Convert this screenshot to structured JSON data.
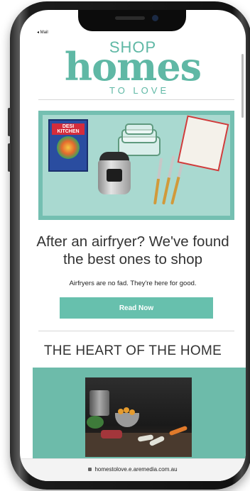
{
  "status_bar": {
    "back_label": "◂ Mail"
  },
  "brand": {
    "top": "SHOP",
    "main": "homes",
    "bottom": "TO LOVE"
  },
  "hero_card": {
    "book_title": "DESI KITCHEN",
    "headline": "After an airfryer? We've found the best ones to shop",
    "subline": "Airfryers are no fad. They're here for good.",
    "cta_label": "Read Now"
  },
  "section": {
    "title": "THE HEART OF THE HOME"
  },
  "browser": {
    "url": "homestolove.e.aremedia.com.au"
  },
  "colors": {
    "accent": "#67c0ad",
    "hero_bg": "#a9d9d0",
    "feature_bg": "#6dbbaa"
  }
}
